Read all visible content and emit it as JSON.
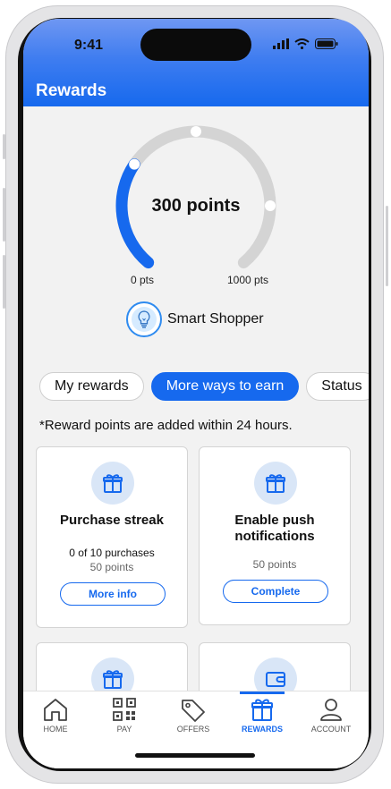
{
  "status_bar": {
    "time": "9:41"
  },
  "header": {
    "title": "Rewards"
  },
  "rewards": {
    "points_label": "300 points",
    "points_value": 300,
    "min_label": "0 pts",
    "max_label": "1000 pts",
    "min_value": 0,
    "max_value": 1000,
    "tier_name": "Smart Shopper"
  },
  "tabs": [
    {
      "label": "My rewards",
      "active": false
    },
    {
      "label": "More ways to earn",
      "active": true
    },
    {
      "label": "Status",
      "active": false
    }
  ],
  "note": "*Reward points are added within 24 hours.",
  "cards": [
    {
      "icon": "gift-icon",
      "title": "Purchase streak",
      "line1": "0 of 10 purchases",
      "line2": "50 points",
      "button": "More info"
    },
    {
      "icon": "gift-icon",
      "title": "Enable push notifications",
      "line2": "50 points",
      "button": "Complete"
    },
    {
      "icon": "gift-icon"
    },
    {
      "icon": "wallet-icon"
    }
  ],
  "nav": [
    {
      "label": "HOME",
      "icon": "home-icon",
      "active": false
    },
    {
      "label": "PAY",
      "icon": "qr-code-icon",
      "active": false
    },
    {
      "label": "OFFERS",
      "icon": "tag-icon",
      "active": false
    },
    {
      "label": "REWARDS",
      "icon": "gift-icon",
      "active": true
    },
    {
      "label": "ACCOUNT",
      "icon": "person-icon",
      "active": false
    }
  ],
  "colors": {
    "accent": "#1669ee",
    "track": "#d4d4d4",
    "icon_bg": "#d9e6f7"
  }
}
